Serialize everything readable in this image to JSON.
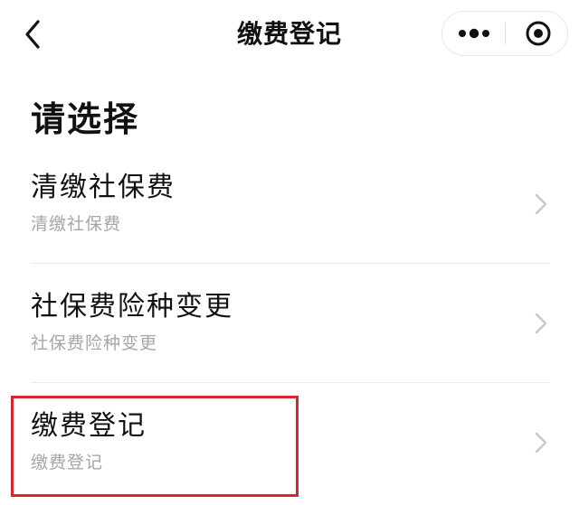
{
  "navbar": {
    "title": "缴费登记",
    "back_icon": "chevron-left-icon",
    "more_icon": "more-dots-icon",
    "close_icon": "target-circle-icon"
  },
  "heading": "请选择",
  "options": [
    {
      "title": "清缴社保费",
      "subtitle": "清缴社保费"
    },
    {
      "title": "社保费险种变更",
      "subtitle": "社保费险种变更"
    },
    {
      "title": "缴费登记",
      "subtitle": "缴费登记"
    }
  ],
  "colors": {
    "highlight": "#d9272e",
    "subtitle": "#a6a6a6",
    "chevron": "#c8c8c8"
  }
}
